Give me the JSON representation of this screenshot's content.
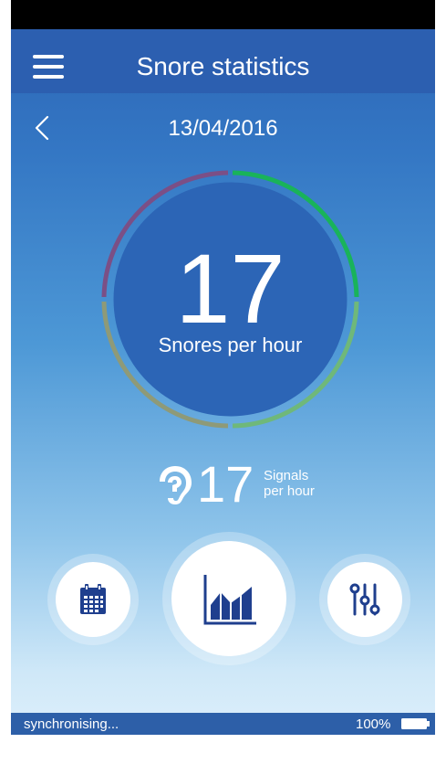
{
  "header": {
    "title": "Snore statistics",
    "date": "13/04/2016"
  },
  "gauge": {
    "value": "17",
    "label": "Snores per hour",
    "segment_colors": [
      "#19b35a",
      "#6fb87a",
      "#8e9a78",
      "#7b4f86"
    ]
  },
  "signals": {
    "value": "17",
    "label_line1": "Signals",
    "label_line2": "per hour"
  },
  "buttons": {
    "calendar_icon": "calendar-icon",
    "statistics_icon": "bar-chart-icon",
    "settings_icon": "sliders-icon",
    "icon_color": "#1f3f8e"
  },
  "footer": {
    "sync_status": "synchronising...",
    "battery_percent": "100%"
  }
}
